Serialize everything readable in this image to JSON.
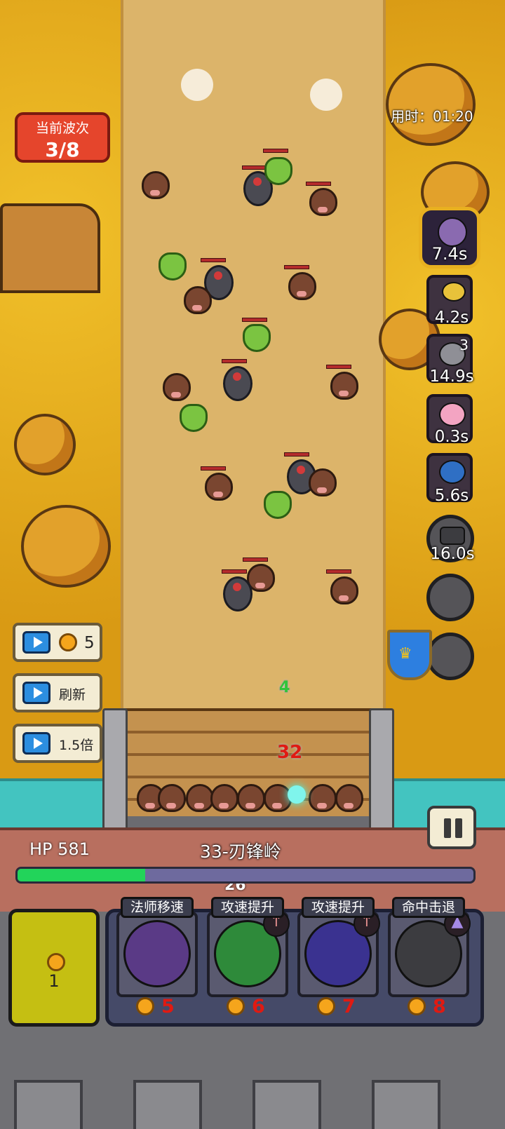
{
  "hud": {
    "wave_title": "当前波次",
    "wave_value": "3/8",
    "timer": "用时：01:20",
    "hp_label": "HP 581",
    "level_name": "33-刃锋岭",
    "hp_fraction": 0.28
  },
  "skills": [
    {
      "icon": "dark-mage-portrait-icon",
      "cooldown": "7.4s"
    },
    {
      "icon": "straw-hat-farmer-icon",
      "cooldown": "4.2s"
    },
    {
      "icon": "viking-warrior-icon",
      "cooldown": "14.9s",
      "count": "3"
    },
    {
      "icon": "nurse-healer-icon",
      "cooldown": "0.3s"
    },
    {
      "icon": "blue-wizard-icon",
      "cooldown": "5.6s"
    },
    {
      "icon": "cannon-icon",
      "cooldown": "16.0s"
    },
    {
      "icon": "empty-slot",
      "cooldown": ""
    },
    {
      "icon": "empty-slot",
      "cooldown": ""
    }
  ],
  "ad_buttons": [
    {
      "icon": "coin-icon",
      "label": "5"
    },
    {
      "label": "刷新"
    },
    {
      "label": "1.5倍"
    }
  ],
  "damage_numbers": {
    "hit": "32",
    "heal": "4",
    "sub": "26"
  },
  "gold": {
    "value": "1"
  },
  "upgrades": [
    {
      "title": "法师移速",
      "cost": "5",
      "icon": "winged-boot-icon"
    },
    {
      "title": "攻速提升",
      "cost": "6",
      "icon": "elf-archer-icon"
    },
    {
      "title": "攻速提升",
      "cost": "7",
      "icon": "blue-wizard-icon"
    },
    {
      "title": "命中击退",
      "cost": "8",
      "icon": "cannon-icon"
    }
  ],
  "colors": {
    "hp_fill": "#22d45a",
    "wave_badge": "#e5452c",
    "cost": "#e01a12"
  }
}
